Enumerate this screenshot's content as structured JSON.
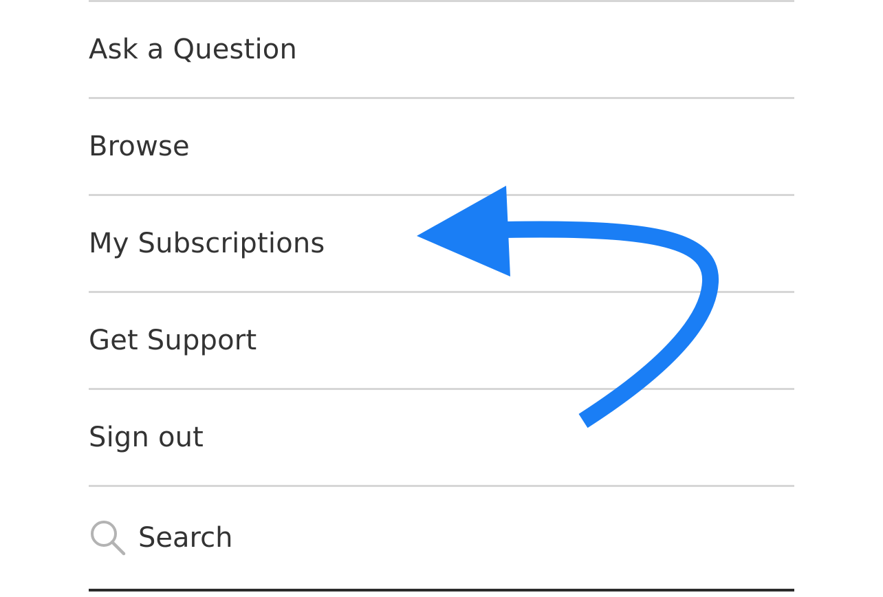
{
  "menu": {
    "items": [
      {
        "label": "Ask a Question"
      },
      {
        "label": "Browse"
      },
      {
        "label": "My Subscriptions"
      },
      {
        "label": "Get Support"
      },
      {
        "label": "Sign out"
      }
    ]
  },
  "search": {
    "placeholder": "Search",
    "icon": "search-icon"
  },
  "annotation": {
    "arrow_color": "#1a7ef5",
    "icon": "curved-arrow-icon"
  },
  "colors": {
    "divider": "#d6d6d6",
    "text": "#333333",
    "search_icon": "#b3b3b3"
  }
}
